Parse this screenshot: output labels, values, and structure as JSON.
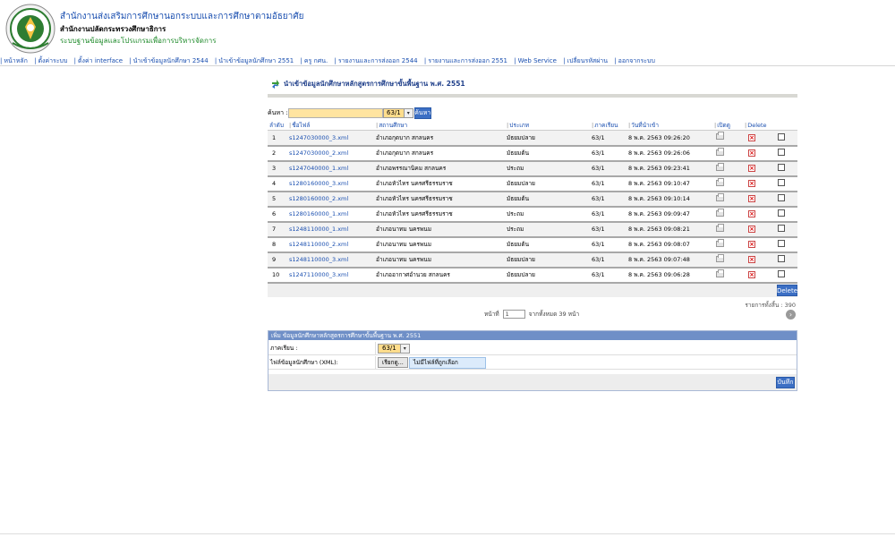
{
  "header": {
    "title": "สำนักงานส่งเสริมการศึกษานอกระบบและการศึกษาตามอัธยาศัย",
    "subtitle": "สำนักงานปลัดกระทรวงศึกษาธิการ",
    "system": "ระบบฐานข้อมูลและโปรแกรมเพื่อการบริหารจัดการ"
  },
  "nav": [
    "หน้าหลัก",
    "ตั้งค่าระบบ",
    "ตั้งค่า interface",
    "นำเข้าข้อมูลนักศึกษา 2544",
    "นำเข้าข้อมูลนักศึกษา 2551",
    "ครู กศน.",
    "รายงานและการส่งออก 2544",
    "รายงานและการส่งออก 2551",
    "Web Service",
    "เปลี่ยนรหัสผ่าน",
    "ออกจากระบบ"
  ],
  "page": {
    "title": "นำเข้าข้อมูลนักศึกษาหลักสูตรการศึกษาขั้นพื้นฐาน พ.ศ. 2551"
  },
  "search": {
    "label": "ค้นหา :",
    "value": "",
    "semester": "63/1",
    "button": "ค้นหา"
  },
  "table": {
    "headers": [
      "ลำดับ",
      "ชื่อไฟล์",
      "สถานศึกษา",
      "ประเภท",
      "ภาคเรียน",
      "วันที่นำเข้า",
      "เปิดดู",
      "Delete"
    ],
    "rows": [
      {
        "no": "1",
        "file": "s1247030000_3.xml",
        "school": "อำเภอกุดบาก สกลนคร",
        "type": "มัธยมปลาย",
        "term": "63/1",
        "date": "8 พ.ค. 2563 09:26:20"
      },
      {
        "no": "2",
        "file": "s1247030000_2.xml",
        "school": "อำเภอกุดบาก สกลนคร",
        "type": "มัธยมต้น",
        "term": "63/1",
        "date": "8 พ.ค. 2563 09:26:06"
      },
      {
        "no": "3",
        "file": "s1247040000_1.xml",
        "school": "อำเภอพรรณานิคม สกลนคร",
        "type": "ประถม",
        "term": "63/1",
        "date": "8 พ.ค. 2563 09:23:41"
      },
      {
        "no": "4",
        "file": "s1280160000_3.xml",
        "school": "อำเภอหัวไทร นครศรีธรรมราช",
        "type": "มัธยมปลาย",
        "term": "63/1",
        "date": "8 พ.ค. 2563 09:10:47"
      },
      {
        "no": "5",
        "file": "s1280160000_2.xml",
        "school": "อำเภอหัวไทร นครศรีธรรมราช",
        "type": "มัธยมต้น",
        "term": "63/1",
        "date": "8 พ.ค. 2563 09:10:14"
      },
      {
        "no": "6",
        "file": "s1280160000_1.xml",
        "school": "อำเภอหัวไทร นครศรีธรรมราช",
        "type": "ประถม",
        "term": "63/1",
        "date": "8 พ.ค. 2563 09:09:47"
      },
      {
        "no": "7",
        "file": "s1248110000_1.xml",
        "school": "อำเภอนาทม นครพนม",
        "type": "ประถม",
        "term": "63/1",
        "date": "8 พ.ค. 2563 09:08:21"
      },
      {
        "no": "8",
        "file": "s1248110000_2.xml",
        "school": "อำเภอนาทม นครพนม",
        "type": "มัธยมต้น",
        "term": "63/1",
        "date": "8 พ.ค. 2563 09:08:07"
      },
      {
        "no": "9",
        "file": "s1248110000_3.xml",
        "school": "อำเภอนาทม นครพนม",
        "type": "มัธยมปลาย",
        "term": "63/1",
        "date": "8 พ.ค. 2563 09:07:48"
      },
      {
        "no": "10",
        "file": "s1247110000_3.xml",
        "school": "อำเภออากาศอำนวย สกลนคร",
        "type": "มัธยมปลาย",
        "term": "63/1",
        "date": "8 พ.ค. 2563 09:06:28"
      }
    ],
    "delete_button": "Delete",
    "total": "รายการทั้งสิ้น : 390"
  },
  "pager": {
    "label": "หน้าที่",
    "page": "1",
    "of_total": "จากทั้งหมด 39 หน้า"
  },
  "add": {
    "title": "เพิ่ม ข้อมูลนักศึกษาหลักสูตรการศึกษาขั้นพื้นฐาน พ.ศ. 2551",
    "semester_label": "ภาคเรียน :",
    "semester_value": "63/1",
    "file_label": "ไฟล์ข้อมูลนักศึกษา (XML):",
    "browse_button": "เรียกดู...",
    "file_status": "ไม่มีไฟล์ที่ถูกเลือก",
    "save_button": "บันทึก"
  }
}
